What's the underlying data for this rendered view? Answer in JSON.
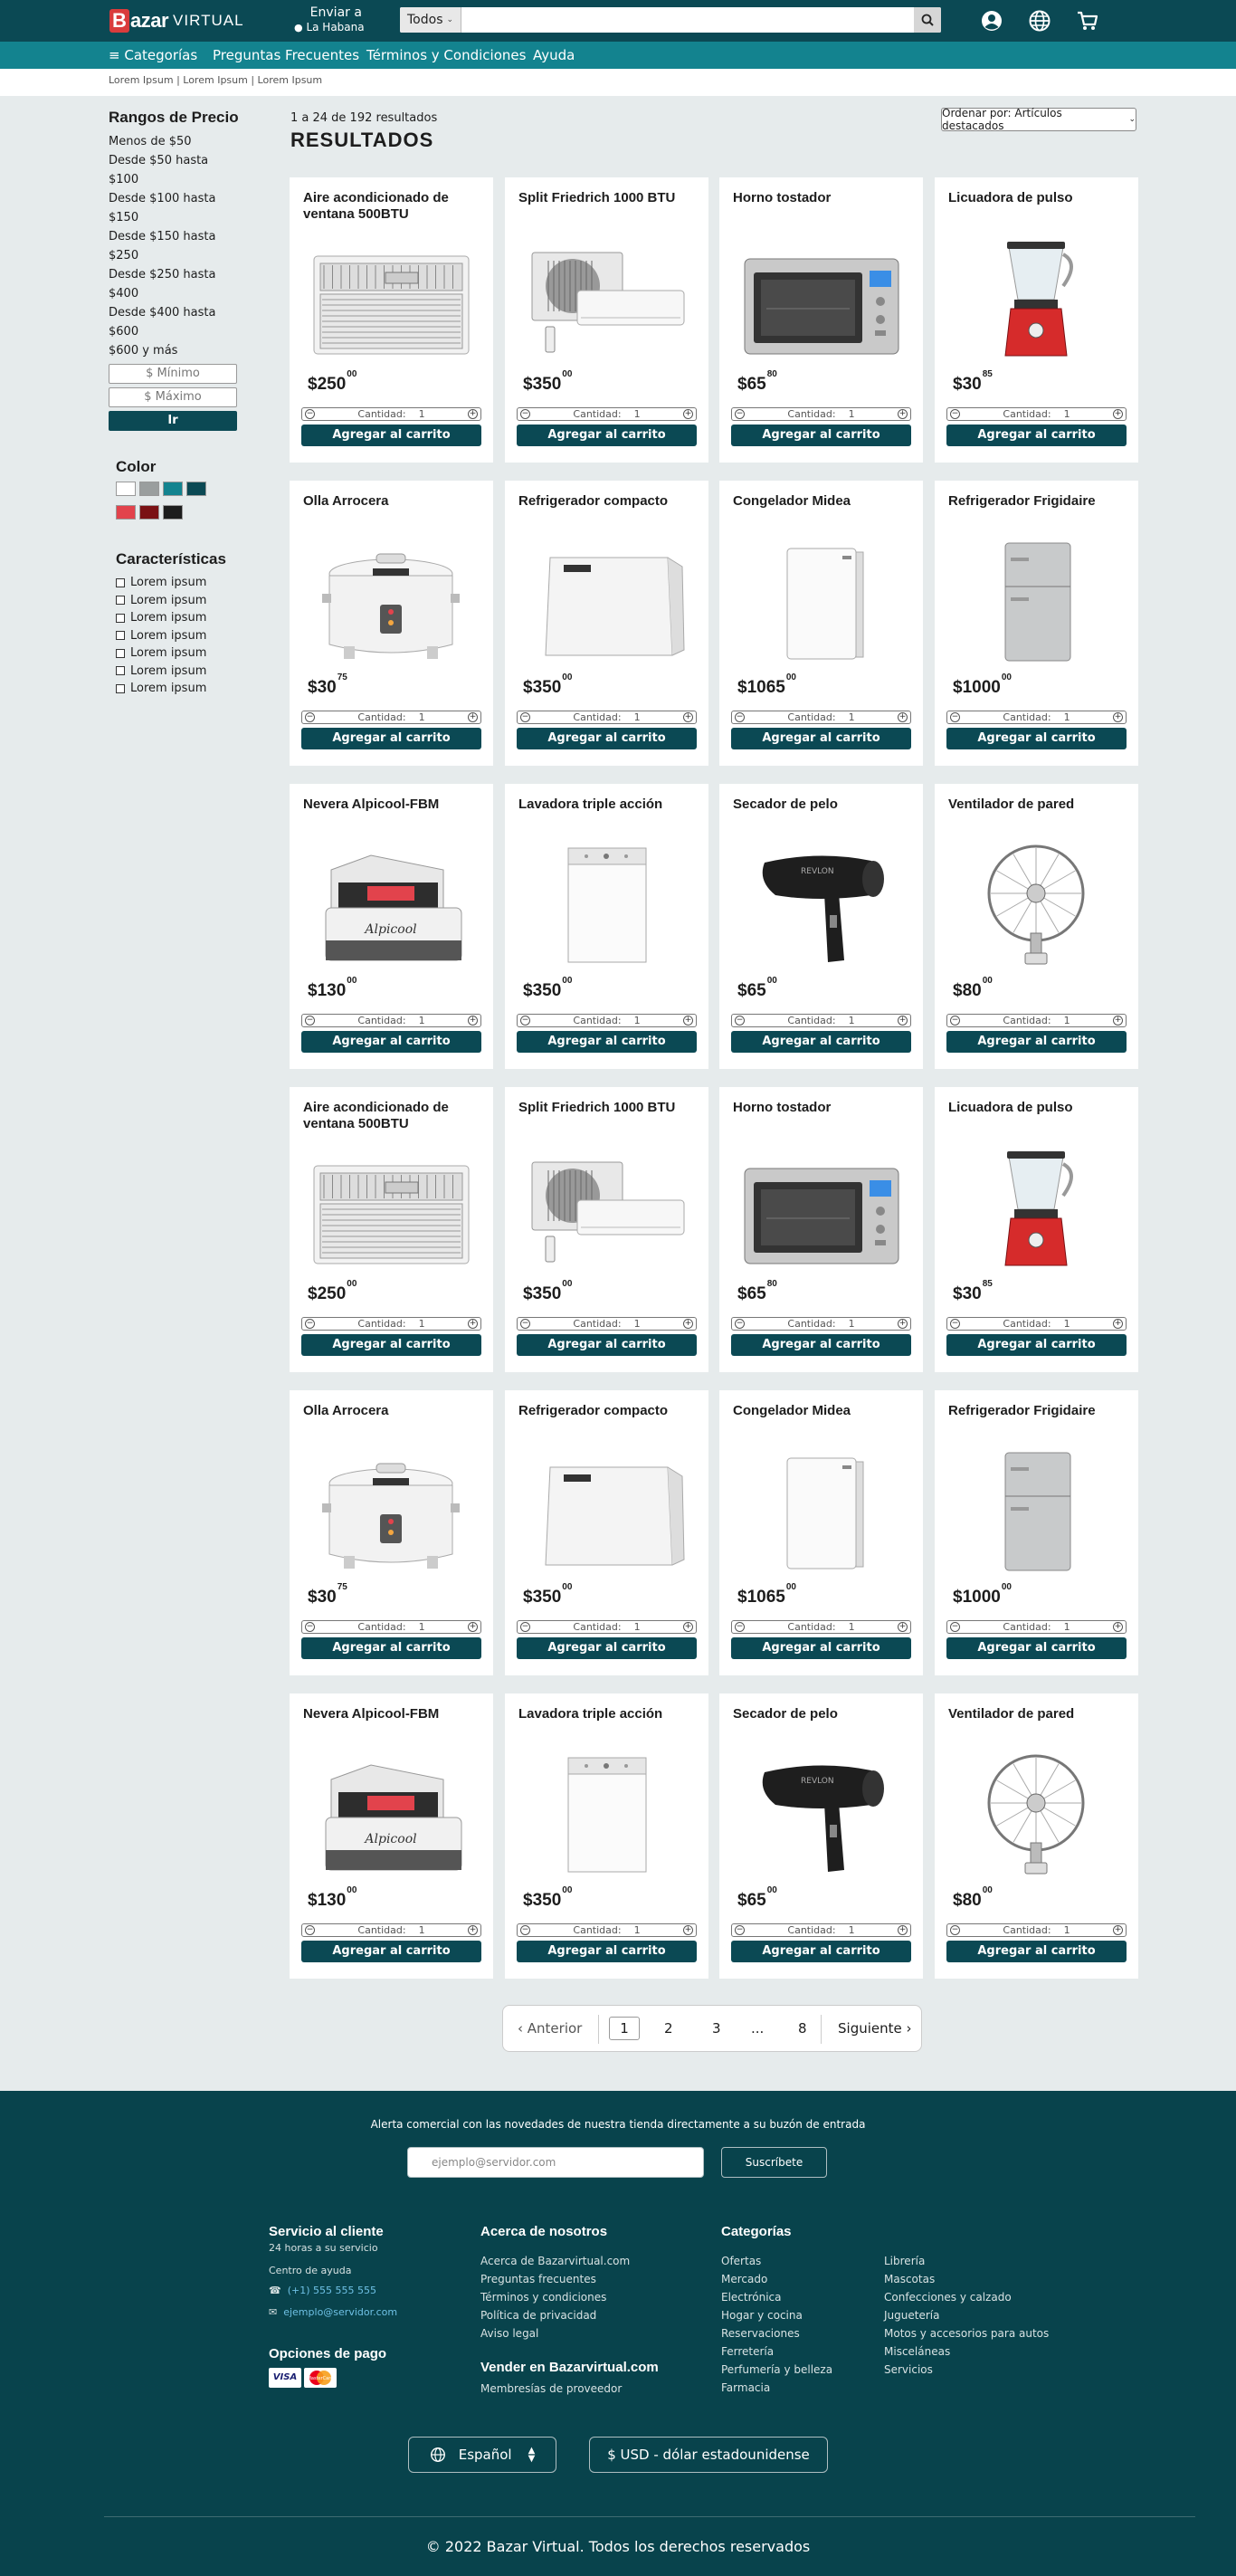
{
  "header": {
    "logo_letter": "B",
    "logo_main": "azar",
    "logo_sub": "VIRTUAL",
    "ship_line1": "Enviar a",
    "ship_line2": "La Habana",
    "search_category": "Todos",
    "search_placeholder": "",
    "icons": [
      "user-icon",
      "globe-icon",
      "cart-icon"
    ]
  },
  "nav": {
    "categories": "Categorías",
    "faq": "Preguntas Frecuentes",
    "terms": "Términos y Condiciones",
    "help": "Ayuda"
  },
  "breadcrumb": "Lorem Ipsum | Lorem Ipsum | Lorem Ipsum",
  "sidebar": {
    "price_title": "Rangos de Precio",
    "prices": [
      "Menos de $50",
      "Desde $50 hasta $100",
      "Desde $100 hasta $150",
      "Desde $150 hasta $250",
      "Desde $250 hasta $400",
      "Desde $400 hasta $600",
      "$600 y más"
    ],
    "min_placeholder": "$ Mínimo",
    "max_placeholder": "$ Máximo",
    "go": "Ir",
    "color_title": "Color",
    "colors": [
      "#ffffff",
      "#9a9e9e",
      "#13838f",
      "#0b4954",
      "#e2434c",
      "#7a1114",
      "#1d1d1d"
    ],
    "features_title": "Características",
    "features": [
      "Lorem ipsum",
      "Lorem ipsum",
      "Lorem ipsum",
      "Lorem ipsum",
      "Lorem ipsum",
      "Lorem ipsum",
      "Lorem ipsum"
    ]
  },
  "results": {
    "count": "1 a 24 de 192 resultados",
    "title": "RESULTADOS",
    "sort": "Ordenar por: Artículos destacados"
  },
  "product_labels": {
    "qty": "Cantidad:",
    "qty_value": "1",
    "minus": "−",
    "plus": "+",
    "add": "Agregar al carrito"
  },
  "products": [
    {
      "name": "Aire acondicionado de ventana 500BTU",
      "price": "$250",
      "cents": "00",
      "icon": "window-ac-image"
    },
    {
      "name": "Split Friedrich 1000 BTU",
      "price": "$350",
      "cents": "00",
      "icon": "split-ac-image"
    },
    {
      "name": "Horno tostador",
      "price": "$65",
      "cents": "80",
      "icon": "toaster-oven-image"
    },
    {
      "name": "Licuadora de pulso",
      "price": "$30",
      "cents": "85",
      "icon": "blender-image"
    },
    {
      "name": "Olla Arrocera",
      "price": "$30",
      "cents": "75",
      "icon": "rice-cooker-image"
    },
    {
      "name": "Refrigerador compacto",
      "price": "$350",
      "cents": "00",
      "icon": "compact-fridge-image"
    },
    {
      "name": "Congelador Midea",
      "price": "$1065",
      "cents": "00",
      "icon": "freezer-image"
    },
    {
      "name": "Refrigerador Frigidaire",
      "price": "$1000",
      "cents": "00",
      "icon": "fridge-image"
    },
    {
      "name": "Nevera Alpicool-FBM",
      "price": "$130",
      "cents": "00",
      "icon": "cooler-image"
    },
    {
      "name": "Lavadora triple acción",
      "price": "$350",
      "cents": "00",
      "icon": "washer-image"
    },
    {
      "name": "Secador de pelo",
      "price": "$65",
      "cents": "00",
      "icon": "hair-dryer-image"
    },
    {
      "name": "Ventilador de pared",
      "price": "$80",
      "cents": "00",
      "icon": "wall-fan-image"
    },
    {
      "name": "Aire acondicionado de ventana 500BTU",
      "price": "$250",
      "cents": "00",
      "icon": "window-ac-image"
    },
    {
      "name": "Split Friedrich 1000 BTU",
      "price": "$350",
      "cents": "00",
      "icon": "split-ac-image"
    },
    {
      "name": "Horno tostador",
      "price": "$65",
      "cents": "80",
      "icon": "toaster-oven-image"
    },
    {
      "name": "Licuadora de pulso",
      "price": "$30",
      "cents": "85",
      "icon": "blender-image"
    },
    {
      "name": "Olla Arrocera",
      "price": "$30",
      "cents": "75",
      "icon": "rice-cooker-image"
    },
    {
      "name": "Refrigerador compacto",
      "price": "$350",
      "cents": "00",
      "icon": "compact-fridge-image"
    },
    {
      "name": "Congelador Midea",
      "price": "$1065",
      "cents": "00",
      "icon": "freezer-image"
    },
    {
      "name": "Refrigerador Frigidaire",
      "price": "$1000",
      "cents": "00",
      "icon": "fridge-image"
    },
    {
      "name": "Nevera Alpicool-FBM",
      "price": "$130",
      "cents": "00",
      "icon": "cooler-image"
    },
    {
      "name": "Lavadora triple acción",
      "price": "$350",
      "cents": "00",
      "icon": "washer-image"
    },
    {
      "name": "Secador de pelo",
      "price": "$65",
      "cents": "00",
      "icon": "hair-dryer-image"
    },
    {
      "name": "Ventilador de pared",
      "price": "$80",
      "cents": "00",
      "icon": "wall-fan-image"
    }
  ],
  "pagination": {
    "prev": "Anterior",
    "pages": [
      "1",
      "2",
      "3",
      "...",
      "8"
    ],
    "next": "Siguiente",
    "current": "1"
  },
  "footer": {
    "alert": "Alerta comercial con las novedades de nuestra tienda directamente a su buzón de entrada",
    "email_placeholder": "ejemplo@servidor.com",
    "subscribe": "Suscríbete",
    "service_title": "Servicio al cliente",
    "service_hours": "24 horas a su servicio",
    "help_center": "Centro de ayuda",
    "phone": "(+1) 555 555 555",
    "email": "ejemplo@servidor.com",
    "payment_title": "Opciones de pago",
    "visa": "VISA",
    "mastercard": "MasterCard",
    "about_title": "Acerca de nosotros",
    "about_links": [
      "Acerca de Bazarvirtual.com",
      "Preguntas frecuentes",
      "Términos y condiciones",
      "Política de privacidad",
      "Aviso legal"
    ],
    "sell_title": "Vender en Bazarvirtual.com",
    "sell_links": [
      "Membresías de proveedor"
    ],
    "categories_title": "Categorías",
    "categories_col1": [
      "Ofertas",
      "Mercado",
      "Electrónica",
      "Hogar y cocina",
      "Reservaciones",
      "Ferretería",
      "Perfumería y belleza",
      "Farmacia"
    ],
    "categories_col2": [
      "Librería",
      "Mascotas",
      "Confecciones y calzado",
      "Juguetería",
      "Motos y accesorios para autos",
      "Misceláneas",
      "Servicios"
    ],
    "language": "Español",
    "currency": "$ USD - dólar estadounidense",
    "copyright": "© 2022  Bazar Virtual. Todos los derechos reservados"
  }
}
